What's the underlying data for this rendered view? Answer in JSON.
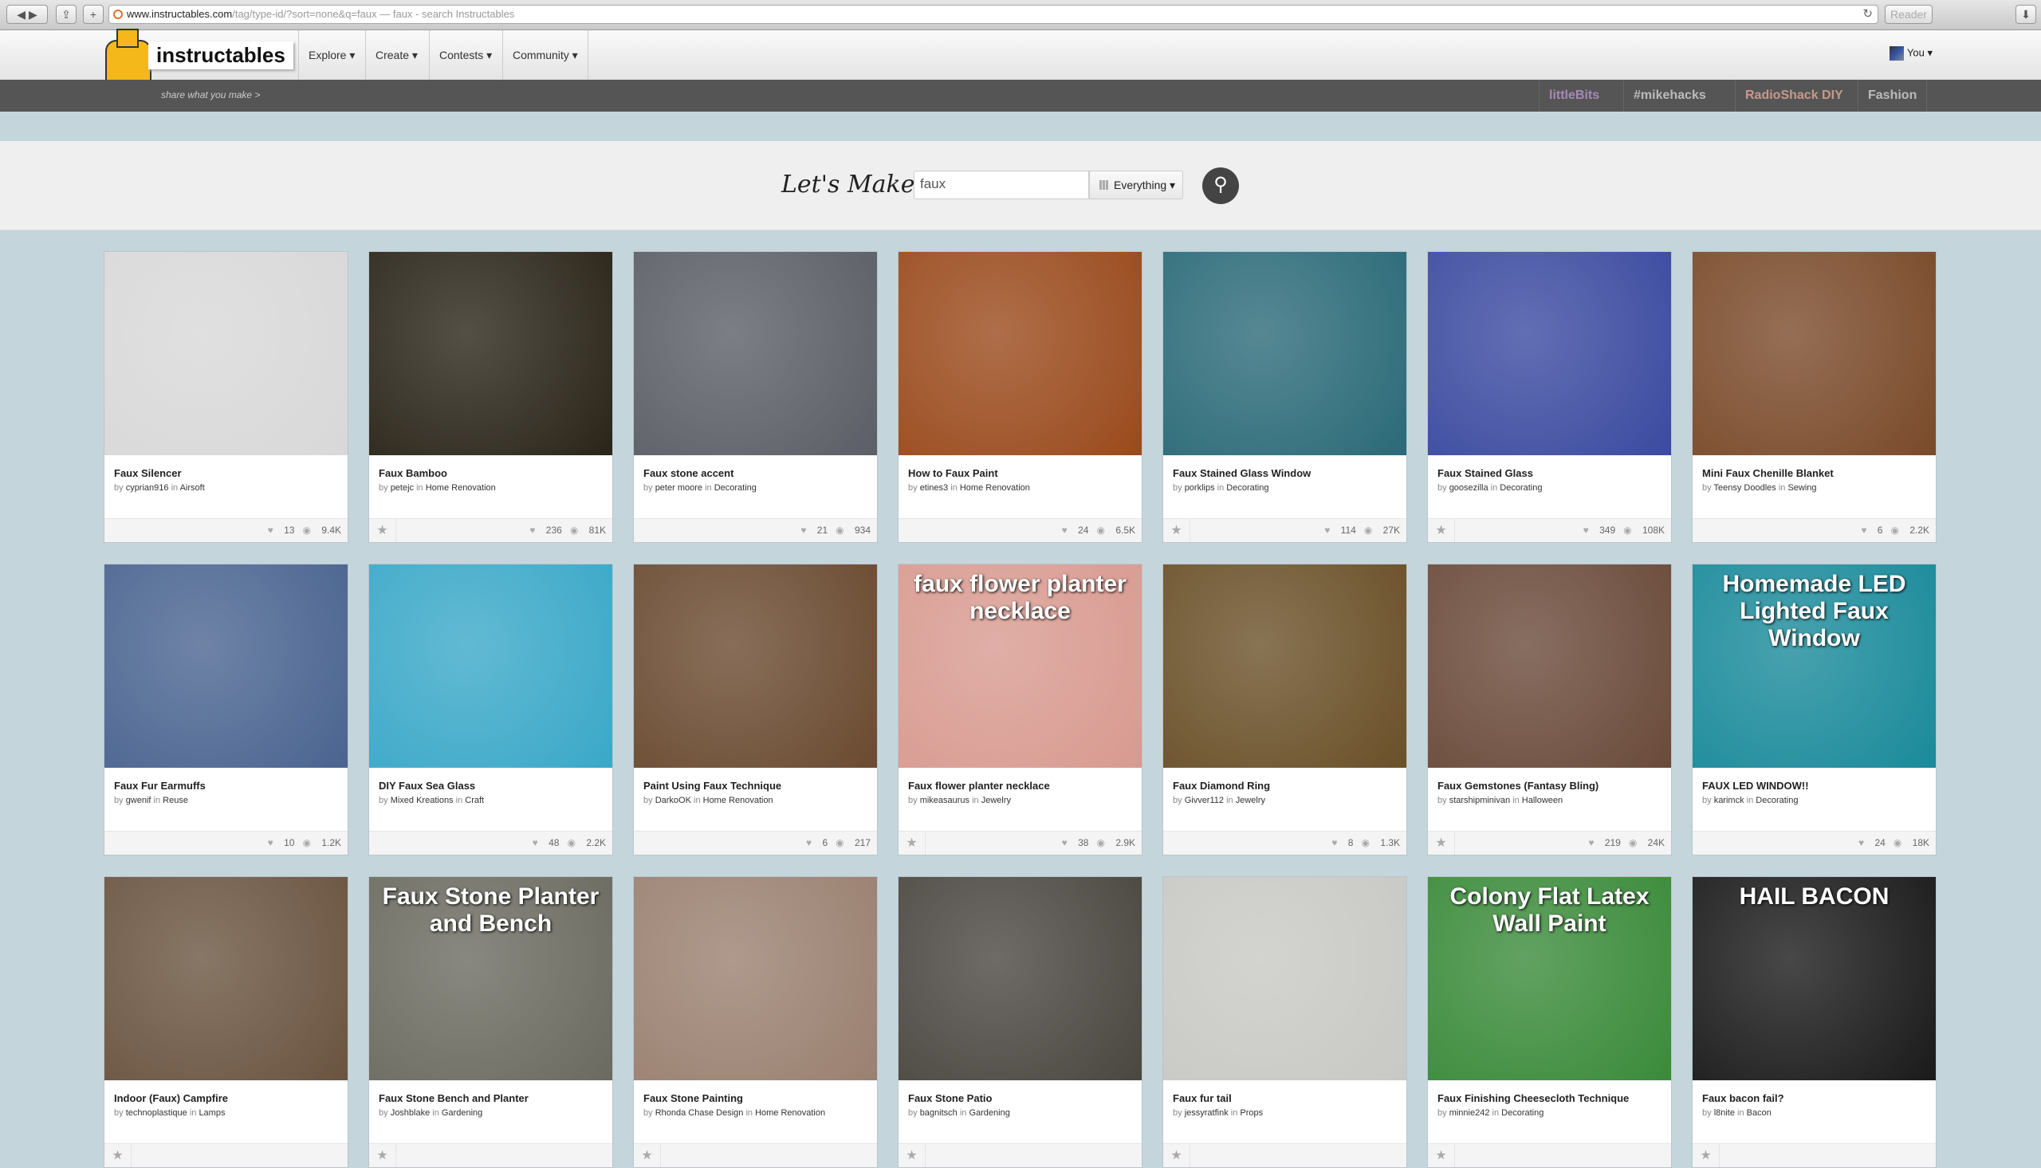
{
  "browser": {
    "url_domain": "www.instructables.com",
    "url_path": "/tag/type-id/?sort=none&q=faux",
    "page_title": " — faux - search Instructables",
    "reader_label": "Reader"
  },
  "nav": {
    "logo": "instructables",
    "tagline": "share what you make >",
    "items": [
      "Explore ▾",
      "Create ▾",
      "Contests ▾",
      "Community ▾"
    ],
    "user": "You ▾"
  },
  "partners": [
    "littleBits",
    "#mikehacks",
    "RadioShack DIY",
    "Fashion"
  ],
  "search": {
    "heading": "Let's Make",
    "query": "faux",
    "filter": "Everything ▾"
  },
  "cards": [
    {
      "title": "Faux Silencer",
      "author": "cyprian916",
      "category": "Airsoft",
      "likes": "13",
      "views": "9.4K",
      "star": false,
      "tone": "#d8d8d8",
      "overlay": ""
    },
    {
      "title": "Faux Bamboo",
      "author": "petejc",
      "category": "Home Renovation",
      "likes": "236",
      "views": "81K",
      "star": true,
      "tone": "#2a2418",
      "overlay": ""
    },
    {
      "title": "Faux stone accent",
      "author": "peter moore",
      "category": "Decorating",
      "likes": "21",
      "views": "934",
      "star": false,
      "tone": "#5b5e66",
      "overlay": ""
    },
    {
      "title": "How to Faux Paint",
      "author": "etines3",
      "category": "Home Renovation",
      "likes": "24",
      "views": "6.5K",
      "star": false,
      "tone": "#9a4a1c",
      "overlay": ""
    },
    {
      "title": "Faux Stained Glass Window",
      "author": "porklips",
      "category": "Decorating",
      "likes": "114",
      "views": "27K",
      "star": true,
      "tone": "#2b6a78",
      "overlay": ""
    },
    {
      "title": "Faux Stained Glass",
      "author": "goosezilla",
      "category": "Decorating",
      "likes": "349",
      "views": "108K",
      "star": true,
      "tone": "#3b4aa0",
      "overlay": ""
    },
    {
      "title": "Mini Faux Chenille Blanket",
      "author": "Teensy Doodles",
      "category": "Sewing",
      "likes": "6",
      "views": "2.2K",
      "star": false,
      "tone": "#7a4a2a",
      "overlay": ""
    },
    {
      "title": "Faux Fur Earmuffs",
      "author": "gwenif",
      "category": "Reuse",
      "likes": "10",
      "views": "1.2K",
      "star": false,
      "tone": "#4a6490",
      "overlay": ""
    },
    {
      "title": "DIY Faux Sea Glass",
      "author": "Mixed Kreations",
      "category": "Craft",
      "likes": "48",
      "views": "2.2K",
      "star": false,
      "tone": "#3aa8c8",
      "overlay": ""
    },
    {
      "title": "Paint Using Faux Technique",
      "author": "DarkoOK",
      "category": "Home Renovation",
      "likes": "6",
      "views": "217",
      "star": false,
      "tone": "#6a4a30",
      "overlay": ""
    },
    {
      "title": "Faux flower planter necklace",
      "author": "mikeasaurus",
      "category": "Jewelry",
      "likes": "38",
      "views": "2.9K",
      "star": true,
      "tone": "#d89a90",
      "overlay": "faux flower planter necklace"
    },
    {
      "title": "Faux Diamond Ring",
      "author": "Givver112",
      "category": "Jewelry",
      "likes": "8",
      "views": "1.3K",
      "star": false,
      "tone": "#6a5028",
      "overlay": ""
    },
    {
      "title": "Faux Gemstones (Fantasy Bling)",
      "author": "starshipminivan",
      "category": "Halloween",
      "likes": "219",
      "views": "24K",
      "star": true,
      "tone": "#6a4a3a",
      "overlay": ""
    },
    {
      "title": "FAUX LED WINDOW!!",
      "author": "karimck",
      "category": "Decorating",
      "likes": "24",
      "views": "18K",
      "star": false,
      "tone": "#1a8a9a",
      "overlay": "Homemade LED Lighted Faux Window"
    },
    {
      "title": "Indoor (Faux) Campfire",
      "author": "technoplastique",
      "category": "Lamps",
      "likes": "",
      "views": "",
      "star": true,
      "tone": "#6a5440",
      "overlay": ""
    },
    {
      "title": "Faux Stone Bench and Planter",
      "author": "Joshblake",
      "category": "Gardening",
      "likes": "",
      "views": "",
      "star": true,
      "tone": "#6a6a60",
      "overlay": "Faux Stone Planter and Bench"
    },
    {
      "title": "Faux Stone Painting",
      "author": "Rhonda Chase Design",
      "category": "Home Renovation",
      "likes": "",
      "views": "",
      "star": true,
      "tone": "#9a8070",
      "overlay": ""
    },
    {
      "title": "Faux Stone Patio",
      "author": "bagnitsch",
      "category": "Gardening",
      "likes": "",
      "views": "",
      "star": true,
      "tone": "#4a4640",
      "overlay": ""
    },
    {
      "title": "Faux fur tail",
      "author": "jessyratfink",
      "category": "Props",
      "likes": "",
      "views": "",
      "star": true,
      "tone": "#c8c8c4",
      "overlay": ""
    },
    {
      "title": "Faux Finishing Cheesecloth Technique",
      "author": "minnie242",
      "category": "Decorating",
      "likes": "",
      "views": "",
      "star": true,
      "tone": "#3a8a3a",
      "overlay": "Colony Flat Latex Wall Paint"
    },
    {
      "title": "Faux bacon fail?",
      "author": "l8nite",
      "category": "Bacon",
      "likes": "",
      "views": "",
      "star": true,
      "tone": "#1a1a1a",
      "overlay": "HAIL BACON"
    }
  ],
  "labels": {
    "by": "by",
    "in": "in"
  }
}
